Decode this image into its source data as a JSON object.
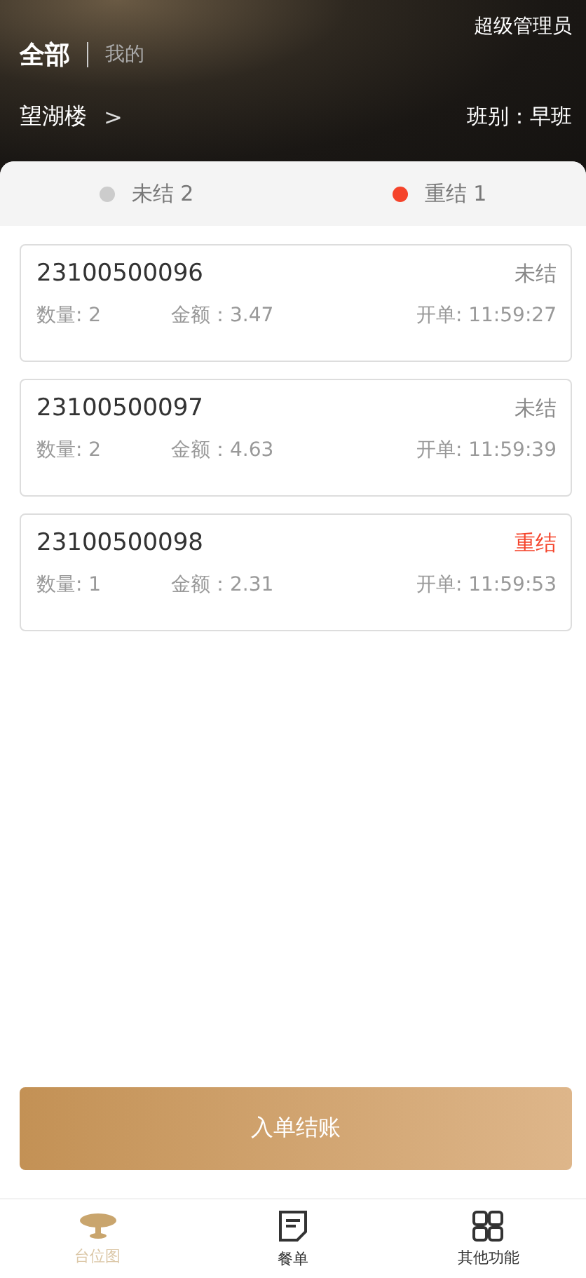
{
  "header": {
    "scope_tabs": [
      {
        "label": "全部",
        "selected": true
      },
      {
        "label": "我的",
        "selected": false
      }
    ],
    "role": "超级管理员",
    "location": "望湖楼",
    "location_arrow": ">",
    "shift": "班别：早班"
  },
  "status_filters": [
    {
      "label": "未结 2",
      "color": "#cccccc"
    },
    {
      "label": "重结 1",
      "color": "#f5432a"
    }
  ],
  "orders": [
    {
      "number": "23100500096",
      "status": "未结",
      "color": "#888888",
      "quantity": "数量: 2",
      "amount": "金额：3.47",
      "opened": "开单: 11:59:27"
    },
    {
      "number": "23100500097",
      "status": "未结",
      "color": "#888888",
      "quantity": "数量: 2",
      "amount": "金额：4.63",
      "opened": "开单: 11:59:39"
    },
    {
      "number": "23100500098",
      "status": "重结",
      "color": "#f5432a",
      "quantity": "数量: 1",
      "amount": "金额：2.31",
      "opened": "开单: 11:59:53"
    }
  ],
  "checkout_button": "入单结账",
  "bottom_nav": [
    {
      "label": "台位图",
      "kind": "table",
      "selected": true
    },
    {
      "label": "餐单",
      "kind": "menu",
      "selected": false
    },
    {
      "label": "其他功能",
      "kind": "grid",
      "selected": false
    }
  ]
}
